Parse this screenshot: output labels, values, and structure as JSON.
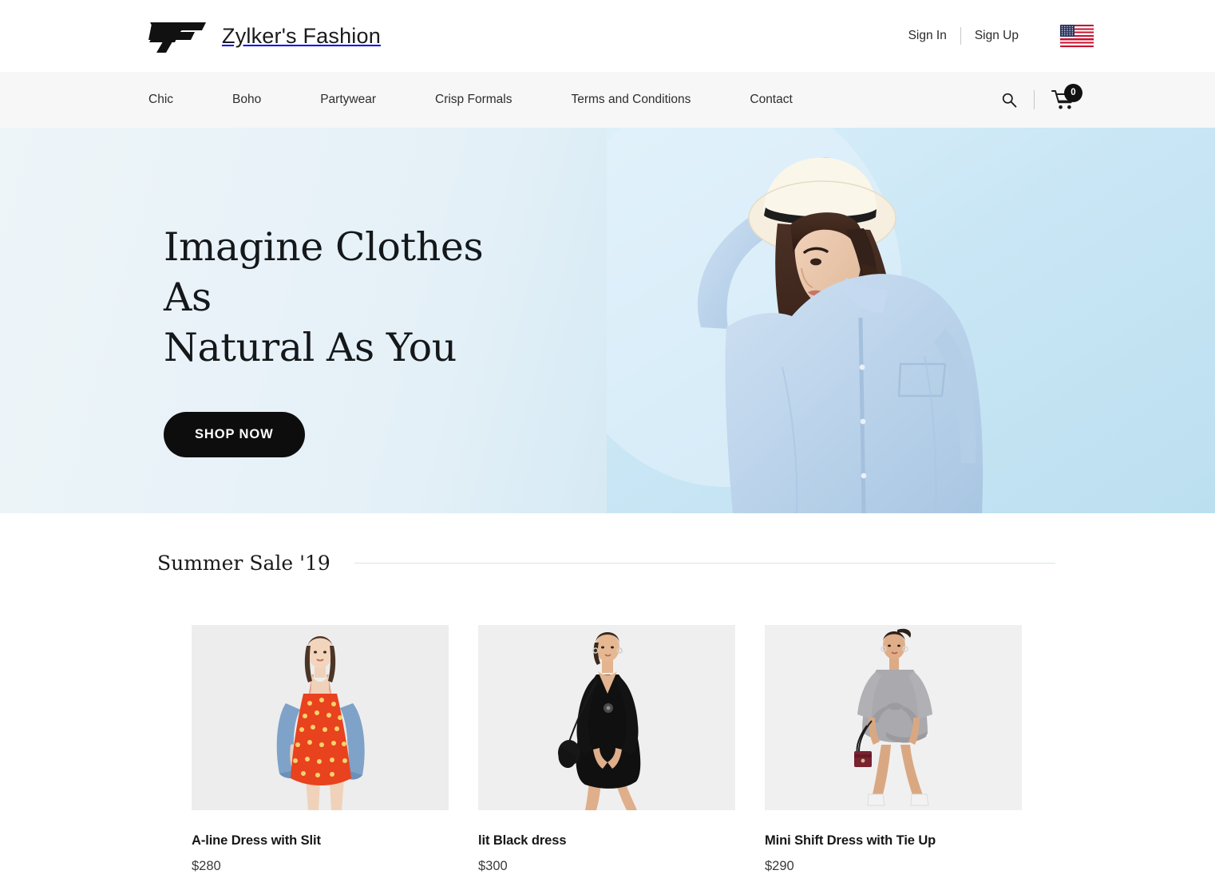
{
  "header": {
    "brand_name": "Zylker's Fashion",
    "logo_icon": "zf-monogram-logo",
    "sign_in": "Sign In",
    "sign_up": "Sign Up",
    "flag_icon": "us-flag-icon",
    "flag_colors": {
      "red": "#c8102e",
      "blue": "#2a3560",
      "white": "#ffffff"
    }
  },
  "nav": {
    "items": [
      {
        "label": "Chic"
      },
      {
        "label": "Boho"
      },
      {
        "label": "Partywear"
      },
      {
        "label": "Crisp Formals"
      },
      {
        "label": "Terms and Conditions"
      },
      {
        "label": "Contact"
      }
    ],
    "search_icon": "search-icon",
    "cart_icon": "shopping-cart-icon",
    "cart_count": "0",
    "background": "#f7f7f7"
  },
  "hero": {
    "title_line1": "Imagine Clothes As",
    "title_line2": "Natural As You",
    "cta_label": "SHOP NOW",
    "cta_background": "#0d0d0d",
    "image_alt": "woman-in-blue-denim-shirt-with-white-hat",
    "background_start": "#eef5f9",
    "background_end": "#bcdff0"
  },
  "section": {
    "title": "Summer Sale '19",
    "rule_color": "#d7e8e4"
  },
  "products": [
    {
      "name": "A-line Dress with Slit",
      "price": "$280",
      "image_alt": "red-floral-a-line-dress-with-denim-jacket"
    },
    {
      "name": "lit Black dress",
      "price": "$300",
      "image_alt": "black-v-neck-mini-dress"
    },
    {
      "name": "Mini Shift Dress with Tie Up",
      "price": "$290",
      "image_alt": "grey-tie-up-mini-shift-dress"
    }
  ]
}
